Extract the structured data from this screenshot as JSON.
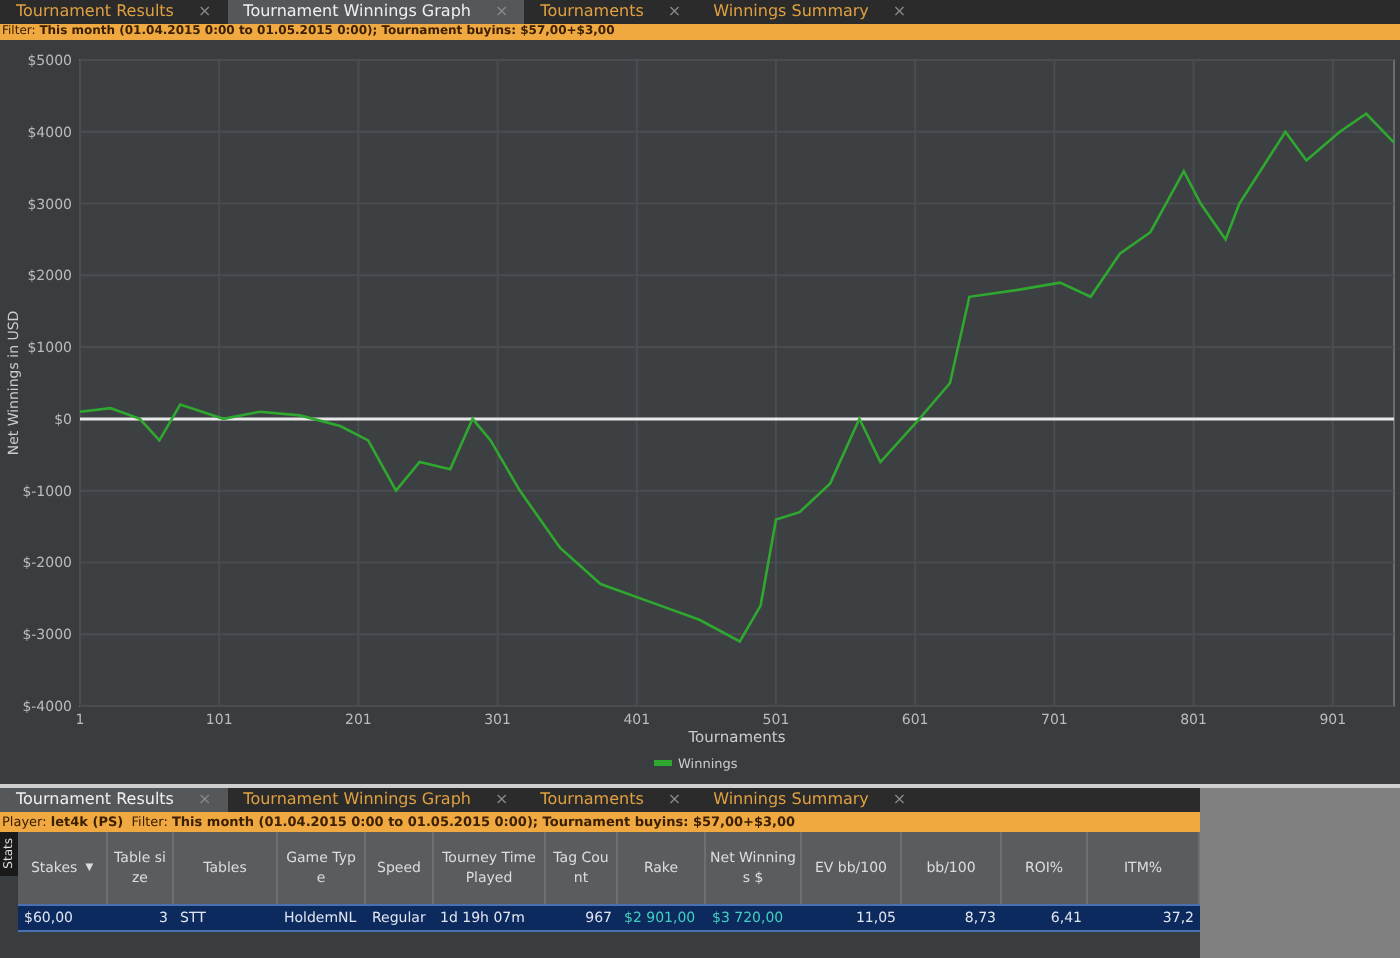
{
  "top_tabs": [
    {
      "label": "Tournament Results",
      "close": "×",
      "selected": false
    },
    {
      "label": "Tournament Winnings Graph",
      "close": "×",
      "selected": true
    },
    {
      "label": "Tournaments",
      "close": "×",
      "selected": false
    },
    {
      "label": "Winnings Summary",
      "close": "×",
      "selected": false
    }
  ],
  "top_filter": "Filter: **This month (01.04.2015 0:00 to 01.05.2015 0:00); Tournament buyins: $57,00+$3,00**",
  "graph": {
    "chart_data": {
      "type": "line",
      "grid": true,
      "xlabel": "Tournaments",
      "ylabel": "Net Winnings in USD",
      "xlim": [
        1,
        945
      ],
      "ylim": [
        -4000,
        5000
      ],
      "xticks": [
        1,
        101,
        201,
        301,
        401,
        501,
        601,
        701,
        801,
        901
      ],
      "yticks": [
        {
          "value": 5000,
          "label": "$5000"
        },
        {
          "value": 4000,
          "label": "$4000"
        },
        {
          "value": 3000,
          "label": "$3000"
        },
        {
          "value": 2000,
          "label": "$2000"
        },
        {
          "value": 1000,
          "label": "$1000"
        },
        {
          "value": 0,
          "label": "$0"
        },
        {
          "value": -1000,
          "label": "$-1000"
        },
        {
          "value": -2000,
          "label": "$-2000"
        },
        {
          "value": -3000,
          "label": "$-3000"
        },
        {
          "value": -4000,
          "label": "$-4000"
        }
      ],
      "x": [
        1,
        23,
        44,
        58,
        73,
        104,
        130,
        159,
        188,
        208,
        228,
        245,
        267,
        283,
        296,
        317,
        346,
        375,
        418,
        446,
        475,
        490,
        501,
        518,
        540,
        561,
        576,
        604,
        626,
        640,
        676,
        705,
        727,
        748,
        770,
        794,
        806,
        824,
        834,
        867,
        882,
        906,
        925,
        945
      ],
      "series": [
        {
          "name": "Winnings",
          "color": "#2ea82e",
          "values": [
            100,
            150,
            0,
            -300,
            200,
            0,
            100,
            50,
            -100,
            -300,
            -1000,
            -600,
            -700,
            0,
            -300,
            -1000,
            -1800,
            -2300,
            -2600,
            -2800,
            -3100,
            -2600,
            -1400,
            -1300,
            -900,
            0,
            -600,
            0,
            500,
            1700,
            1800,
            1900,
            1700,
            2300,
            2600,
            3450,
            3000,
            2500,
            3000,
            4000,
            3600,
            4000,
            4250,
            3850
          ]
        }
      ]
    }
  },
  "bottom_tabs": [
    {
      "label": "Tournament Results",
      "close": "×",
      "selected": true
    },
    {
      "label": "Tournament Winnings Graph",
      "close": "×",
      "selected": false
    },
    {
      "label": "Tournaments",
      "close": "×",
      "selected": false
    },
    {
      "label": "Winnings Summary",
      "close": "×",
      "selected": false
    }
  ],
  "bottom_filter": "Player: **let4k (PS)**  Filter: **This month (01.04.2015 0:00 to 01.05.2015 0:00); Tournament buyins: $57,00+$3,00**",
  "side_tab": "Stats",
  "table": {
    "columns": [
      {
        "label": "Stakes",
        "sort": "▼"
      },
      {
        "label": "Table size"
      },
      {
        "label": "Tables"
      },
      {
        "label": "Game Type"
      },
      {
        "label": "Speed"
      },
      {
        "label": "Tourney Time Played"
      },
      {
        "label": "Tag Count"
      },
      {
        "label": "Rake"
      },
      {
        "label": "Net Winnings $"
      },
      {
        "label": "EV bb/100"
      },
      {
        "label": "bb/100"
      },
      {
        "label": "ROI%"
      },
      {
        "label": "ITM%"
      }
    ],
    "rows": [
      {
        "selected": true,
        "cells": [
          "$60,00",
          "3",
          "STT",
          "HoldemNL",
          "Regular",
          "1d 19h 07m",
          "967",
          "$2 901,00",
          "$3 720,00",
          "11,05",
          "8,73",
          "6,41",
          "37,2"
        ]
      }
    ]
  }
}
